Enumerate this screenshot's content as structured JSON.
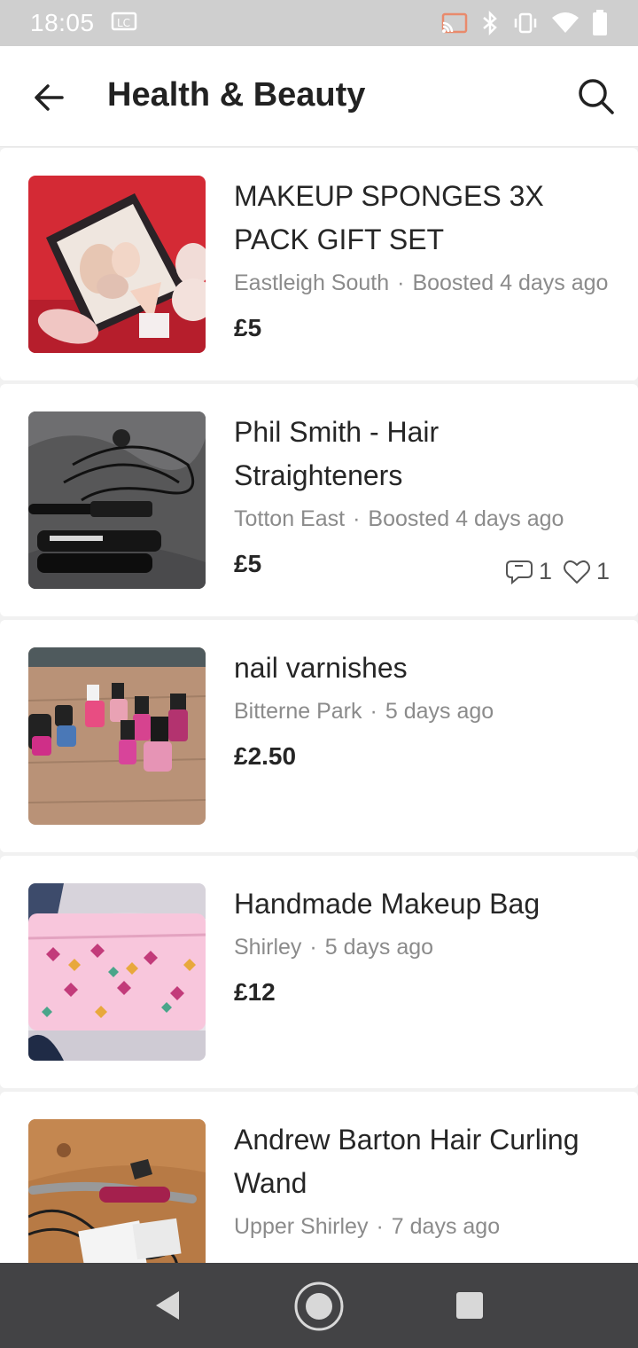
{
  "status_bar": {
    "time": "18:05",
    "icons": [
      "sim-card-icon",
      "cast-icon",
      "bluetooth-icon",
      "vibrate-icon",
      "wifi-icon",
      "battery-icon"
    ]
  },
  "app_bar": {
    "title": "Health & Beauty",
    "back_icon": "arrow-left-icon",
    "search_icon": "search-icon"
  },
  "listings": [
    {
      "title": "MAKEUP SPONGES 3X PACK GIFT SET",
      "location": "Eastleigh South",
      "time": "Boosted 4 days ago",
      "price": "£5",
      "comments": "",
      "likes": ""
    },
    {
      "title": "Phil Smith - Hair Straighteners",
      "location": "Totton East",
      "time": "Boosted 4 days ago",
      "price": "£5",
      "comments": "1",
      "likes": "1"
    },
    {
      "title": "nail varnishes",
      "location": "Bitterne Park",
      "time": "5 days ago",
      "price": "£2.50",
      "comments": "",
      "likes": ""
    },
    {
      "title": "Handmade Makeup Bag",
      "location": "Shirley",
      "time": "5 days ago",
      "price": "£12",
      "comments": "",
      "likes": ""
    },
    {
      "title": "Andrew Barton Hair Curling Wand",
      "location": "Upper Shirley",
      "time": "7 days ago",
      "price": "",
      "comments": "",
      "likes": ""
    }
  ],
  "separator": "·",
  "nav_bar": {
    "icons": [
      "nav-back-icon",
      "nav-home-icon",
      "nav-recents-icon"
    ]
  },
  "colors": {
    "status_bar": "#cfcfcf",
    "nav_bar": "#434345",
    "background": "#f1f1f1",
    "meta_text": "#8b8b8b"
  }
}
